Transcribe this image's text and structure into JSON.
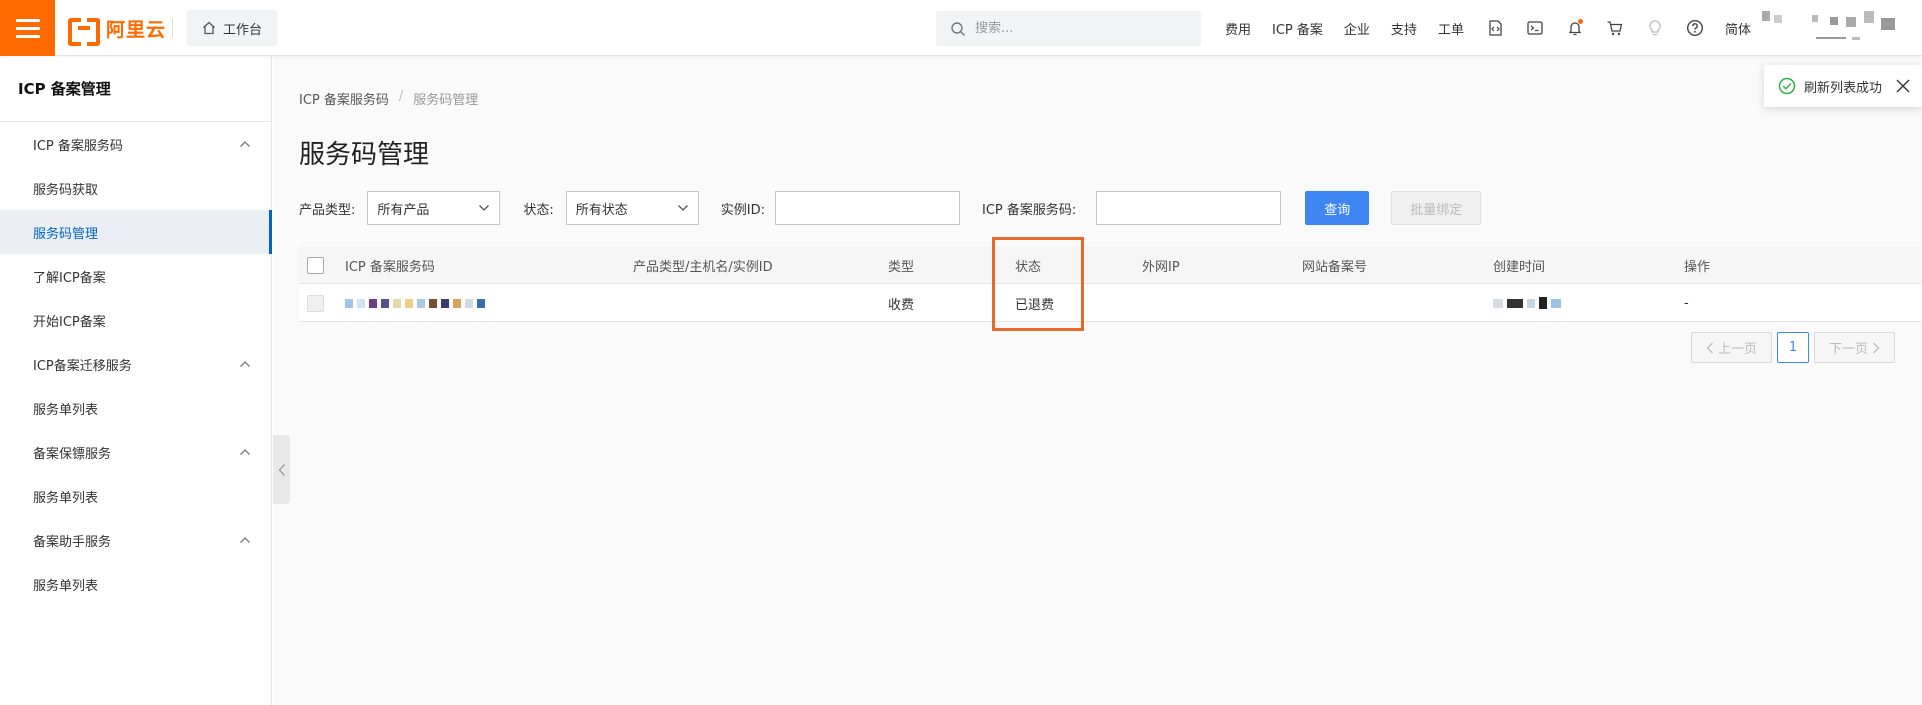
{
  "header": {
    "logo_text": "阿里云",
    "workbench_label": "工作台",
    "search_placeholder": "搜索...",
    "nav": [
      "费用",
      "ICP 备案",
      "企业",
      "支持",
      "工单"
    ],
    "lang_label": "简体",
    "icons": [
      "code-icon",
      "terminal-icon",
      "bell-icon",
      "cart-icon",
      "bulb-icon",
      "help-icon"
    ],
    "accent_color": "#ff6a00"
  },
  "sidebar": {
    "title": "ICP 备案管理",
    "items": [
      {
        "label": "ICP 备案服务码",
        "group": true
      },
      {
        "label": "服务码获取"
      },
      {
        "label": "服务码管理",
        "active": true
      },
      {
        "label": "了解ICP备案"
      },
      {
        "label": "开始ICP备案"
      },
      {
        "label": "ICP备案迁移服务",
        "group": true
      },
      {
        "label": "服务单列表"
      },
      {
        "label": "备案保镖服务",
        "group": true
      },
      {
        "label": "服务单列表"
      },
      {
        "label": "备案助手服务",
        "group": true
      },
      {
        "label": "服务单列表"
      }
    ]
  },
  "main": {
    "breadcrumb": {
      "parent": "ICP 备案服务码",
      "separator": "/",
      "current": "服务码管理"
    },
    "title": "服务码管理",
    "filters": {
      "product_type_label": "产品类型:",
      "product_type_value": "所有产品",
      "status_label": "状态:",
      "status_value": "所有状态",
      "instance_id_label": "实例ID:",
      "instance_id_value": "",
      "service_code_label": "ICP 备案服务码:",
      "service_code_value": "",
      "query_button": "查询",
      "bind_button": "批量绑定"
    },
    "table": {
      "columns": [
        "ICP 备案服务码",
        "产品类型/主机名/实例ID",
        "类型",
        "状态",
        "外网IP",
        "网站备案号",
        "创建时间",
        "操作"
      ],
      "rows": [
        {
          "code": "",
          "product": "",
          "type": "收费",
          "status": "已退费",
          "ip": "",
          "record_no": "",
          "created": "",
          "action": "-"
        }
      ]
    },
    "pagination": {
      "prev": "上一页",
      "current": "1",
      "next": "下一页"
    }
  },
  "toast": {
    "message": "刷新列表成功",
    "success_color": "#2fb24a"
  },
  "highlight_color": "#e86a2b",
  "primary_color": "#3d86f4"
}
